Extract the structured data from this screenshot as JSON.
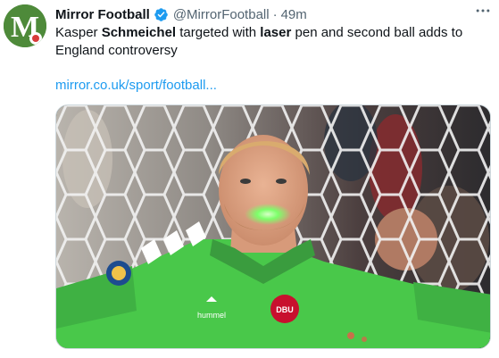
{
  "account": {
    "name": "Mirror Football",
    "handle": "@MirrorFootball",
    "separator": "·",
    "time": "49m",
    "avatar_letter": "M",
    "icon": "verified-badge-icon"
  },
  "tweet": {
    "text_parts": [
      "Kasper ",
      "Schmeichel",
      " targeted with ",
      "laser",
      " pen and second ball adds to England controversy"
    ],
    "link": "mirror.co.uk/sport/football..."
  },
  "photo": {
    "crest_text": "DBU",
    "kit_brand_text": "hummel"
  },
  "colors": {
    "brand_green": "#4e8a3a",
    "link_blue": "#1d9bf0",
    "verified_blue": "#1d9bf0",
    "shirt_green": "#49c84a",
    "laser_green": "#7dff6a"
  }
}
